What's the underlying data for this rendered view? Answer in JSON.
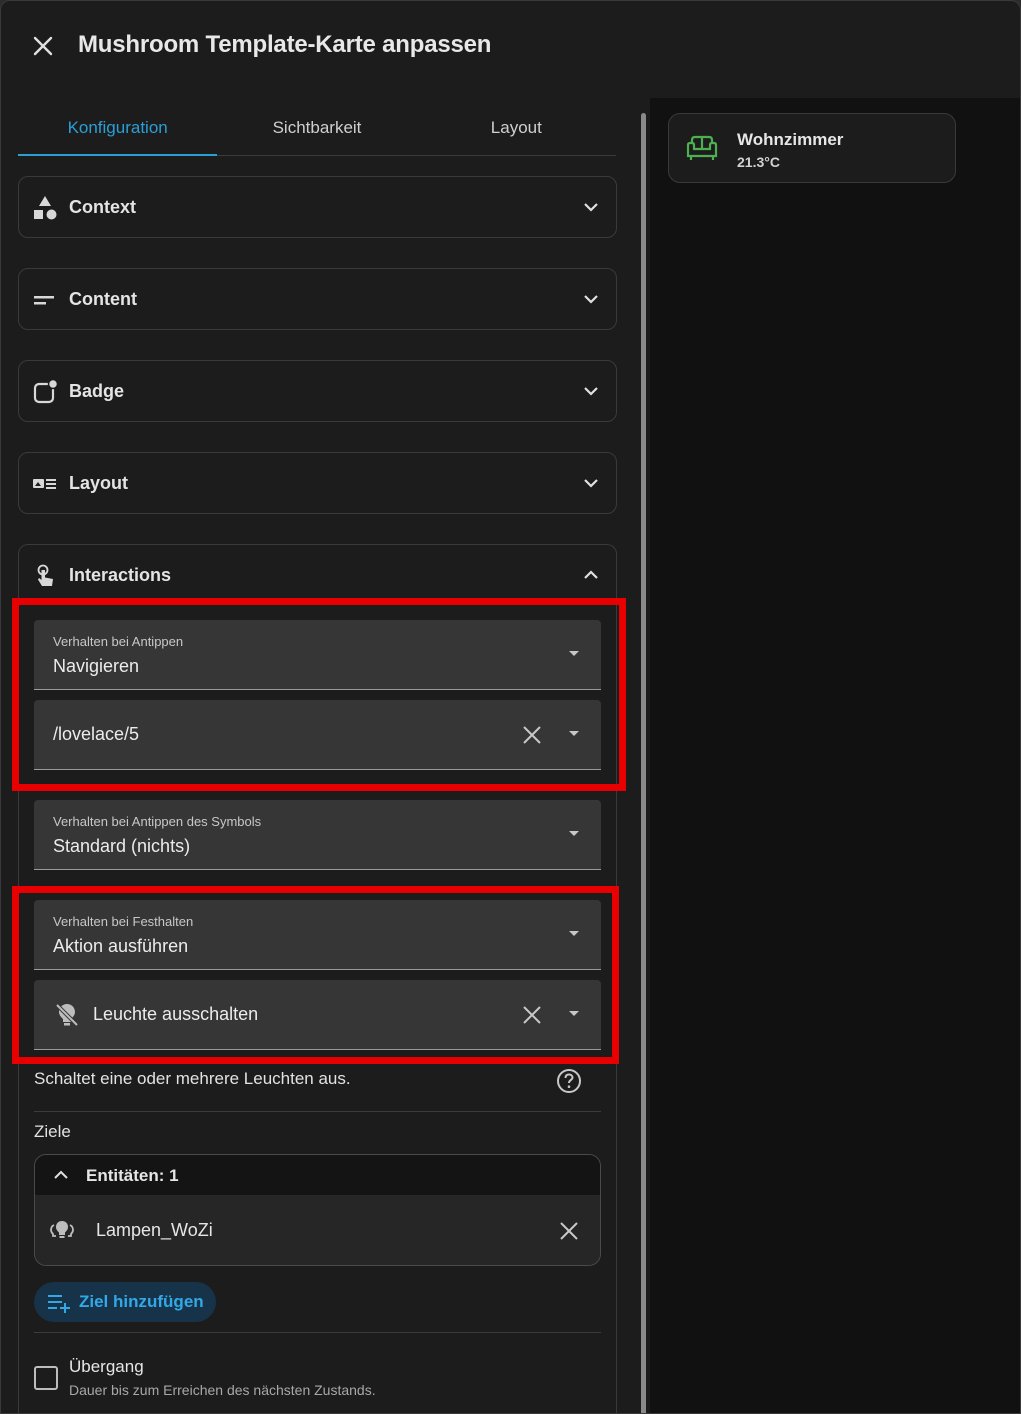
{
  "dialog": {
    "title": "Mushroom Template-Karte anpassen"
  },
  "tabs": [
    {
      "label": "Konfiguration",
      "active": true
    },
    {
      "label": "Sichtbarkeit",
      "active": false
    },
    {
      "label": "Layout",
      "active": false
    }
  ],
  "panels": {
    "context": "Context",
    "content": "Content",
    "badge": "Badge",
    "layout": "Layout",
    "interactions": "Interactions"
  },
  "tap_action": {
    "label": "Verhalten bei Antippen",
    "value": "Navigieren",
    "path": "/lovelace/5"
  },
  "icon_tap_action": {
    "label": "Verhalten bei Antippen des Symbols",
    "value": "Standard (nichts)"
  },
  "hold_action": {
    "label": "Verhalten bei Festhalten",
    "value": "Aktion ausführen",
    "service": "Leuchte ausschalten",
    "description": "Schaltet eine oder mehrere Leuchten aus."
  },
  "targets": {
    "heading": "Ziele",
    "group_label": "Entitäten: 1",
    "entity": "Lampen_WoZi",
    "add_label": "Ziel hinzufügen"
  },
  "transition": {
    "label": "Übergang",
    "sublabel": "Dauer bis zum Erreichen des nächsten Zustands."
  },
  "preview_card": {
    "name": "Wohnzimmer",
    "state": "21.3°C",
    "icon": "sofa-icon"
  },
  "colors": {
    "accent": "#2a9fd6",
    "highlight": "#e80000",
    "card_icon": "#4caf50"
  }
}
